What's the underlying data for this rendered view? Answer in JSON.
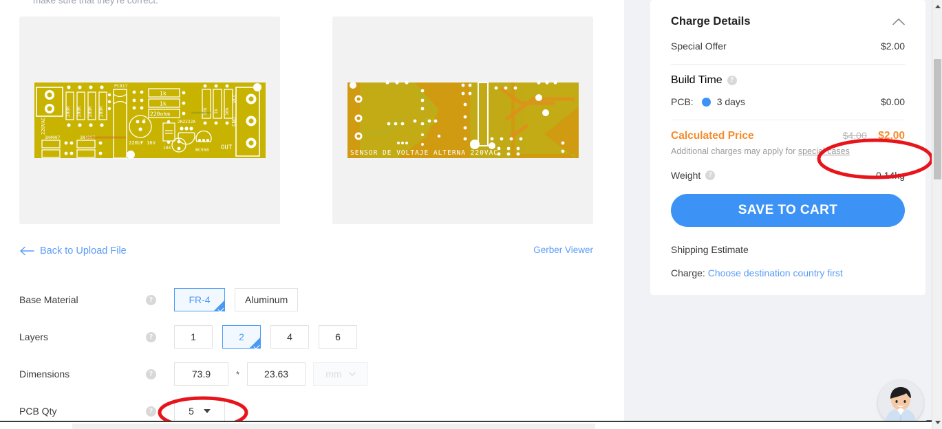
{
  "page": {
    "cut_off_note": "make sure that they're correct.",
    "background_color": "#ffffff",
    "rail_background_color": "#f1f2f6"
  },
  "preview": {
    "front": {
      "alt": "PCB front silkscreen preview",
      "labels": [
        "220VAC",
        "100K",
        "100K",
        "100K",
        "100K",
        "1N4007",
        "1N4007",
        "PC817",
        "1k",
        "1k",
        "220ohm",
        "2N2222A",
        "10k",
        "1k",
        "10k",
        "220UF 16V",
        "104",
        "BC558",
        "GND",
        "VCC",
        "OUT"
      ],
      "board_color": "#c8b400",
      "silk_color": "#ffffff"
    },
    "back": {
      "alt": "PCB back copper preview",
      "labels": [
        "SENSOR DE VOLTAJE ALTERNA 220VAC"
      ],
      "board_color": "#d09b10",
      "silk_color": "#ffffff"
    }
  },
  "links": {
    "back_to_upload": "Back to Upload File",
    "gerber_viewer": "Gerber Viewer",
    "link_color": "#5a9cf8"
  },
  "options": [
    {
      "label": "Base Material",
      "type": "choices",
      "choices": [
        {
          "label": "FR-4",
          "selected": true
        },
        {
          "label": "Aluminum",
          "selected": false
        }
      ]
    },
    {
      "label": "Layers",
      "type": "choices",
      "choices": [
        {
          "label": "1",
          "selected": false
        },
        {
          "label": "2",
          "selected": true
        },
        {
          "label": "4",
          "selected": false
        },
        {
          "label": "6",
          "selected": false
        }
      ]
    },
    {
      "label": "Dimensions",
      "type": "dimensions",
      "width_value": "73.9",
      "separator": "*",
      "height_value": "23.63",
      "unit_value": "mm",
      "unit_disabled": true
    },
    {
      "label": "PCB Qty",
      "type": "select",
      "value": "5"
    }
  ],
  "charge_details": {
    "title": "Charge Details",
    "collapse_icon": "chevron-up-icon",
    "special_offer": {
      "label": "Special Offer",
      "value": "$2.00"
    },
    "build_time": {
      "label": "Build Time",
      "pcb_label": "PCB:",
      "pcb_option": "3 days",
      "pcb_value": "$0.00"
    },
    "calculated_price": {
      "label": "Calculated Price",
      "old_price": "$4.00",
      "new_price": "$2.00",
      "accent_color": "#f78b2b"
    },
    "additional_note_prefix": "Additional charges may apply for ",
    "additional_note_link": "special cases",
    "weight": {
      "label": "Weight",
      "value": "0.14kg"
    },
    "save_to_cart": "SAVE TO CART",
    "shipping_estimate_title": "Shipping Estimate",
    "charge_label": "Charge:",
    "charge_link": "Choose destination country first",
    "button_color": "#3d93f5"
  },
  "annotations": {
    "color": "#e8141b",
    "items": [
      {
        "name": "price-highlight",
        "target": "calculated-price"
      },
      {
        "name": "qty-highlight",
        "target": "pcb-qty-select"
      }
    ]
  },
  "support_widget": {
    "name": "live-chat-avatar",
    "caret": "chevron-down-icon"
  }
}
